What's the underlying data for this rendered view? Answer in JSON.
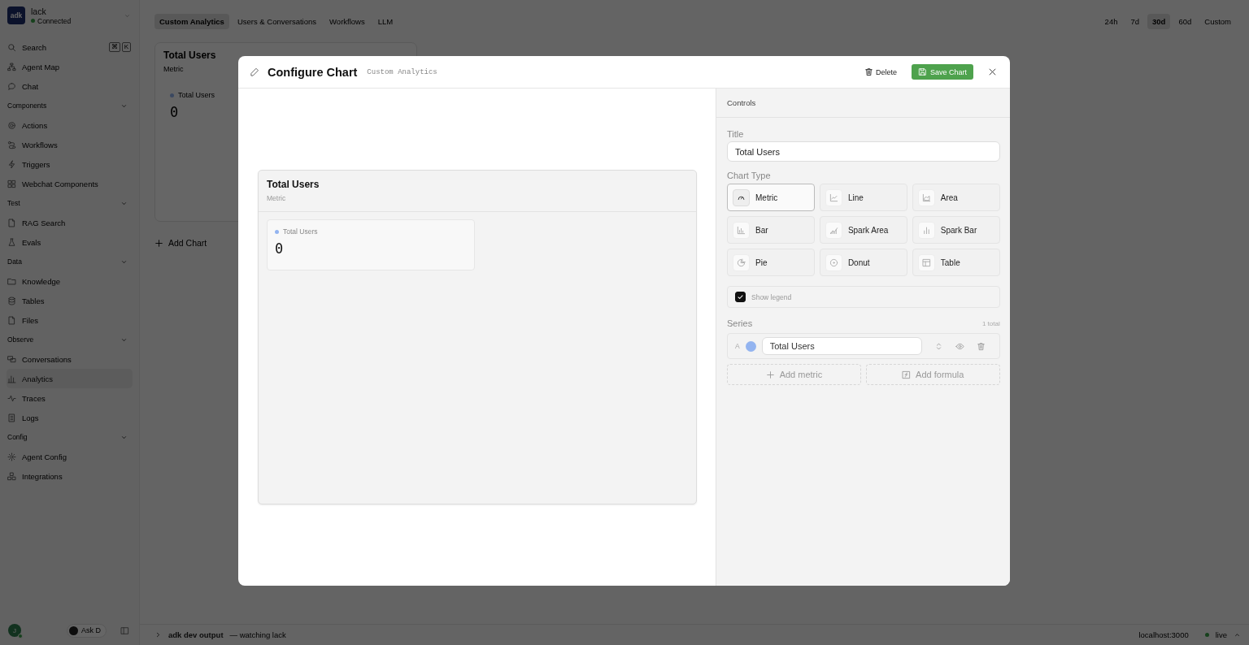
{
  "sidebar": {
    "workspace": {
      "logo": "adk",
      "name": "lack",
      "status": "Connected",
      "connected": true
    },
    "top_items": [
      {
        "label": "Search",
        "keys": [
          "⌘",
          "K"
        ]
      },
      {
        "label": "Agent Map"
      },
      {
        "label": "Chat"
      }
    ],
    "sections": [
      {
        "title": "Components",
        "expanded": true,
        "items": [
          {
            "label": "Actions",
            "selected": false
          },
          {
            "label": "Workflows",
            "selected": false
          },
          {
            "label": "Triggers",
            "selected": false
          },
          {
            "label": "Webchat Components",
            "selected": false
          }
        ]
      },
      {
        "title": "Test",
        "expanded": true,
        "items": [
          {
            "label": "RAG Search",
            "selected": false
          },
          {
            "label": "Evals",
            "selected": false
          }
        ]
      },
      {
        "title": "Data",
        "expanded": true,
        "items": [
          {
            "label": "Knowledge",
            "selected": false
          },
          {
            "label": "Tables",
            "selected": false
          },
          {
            "label": "Files",
            "selected": false
          }
        ]
      },
      {
        "title": "Observe",
        "expanded": true,
        "items": [
          {
            "label": "Conversations",
            "selected": false
          },
          {
            "label": "Analytics",
            "selected": true
          },
          {
            "label": "Traces",
            "selected": false
          },
          {
            "label": "Logs",
            "selected": false
          }
        ]
      },
      {
        "title": "Config",
        "expanded": true,
        "items": [
          {
            "label": "Agent Config",
            "selected": false
          },
          {
            "label": "Integrations",
            "selected": false
          }
        ]
      }
    ],
    "footer": {
      "avatar": "J",
      "ask": "Ask D"
    }
  },
  "tabs": [
    {
      "label": "Custom Analytics",
      "selected": true
    },
    {
      "label": "Users & Conversations",
      "selected": false
    },
    {
      "label": "Workflows",
      "selected": false
    },
    {
      "label": "LLM",
      "selected": false
    }
  ],
  "ranges": [
    {
      "label": "24h",
      "selected": false
    },
    {
      "label": "7d",
      "selected": false
    },
    {
      "label": "30d",
      "selected": true
    },
    {
      "label": "60d",
      "selected": false
    },
    {
      "label": "Custom",
      "selected": false
    }
  ],
  "dashboard_card": {
    "title": "Total Users",
    "type": "Metric",
    "legend": "Total Users",
    "value": "0"
  },
  "add_chart": "Add Chart",
  "output_bar": {
    "title": "adk dev output",
    "status": "— watching lack",
    "host": "localhost:3000",
    "live": "live"
  },
  "dialog": {
    "title": "Configure Chart",
    "subtitle": "Custom Analytics",
    "delete": "Delete",
    "save": "Save Chart",
    "preview": {
      "title": "Total Users",
      "type": "Metric",
      "legend": "Total Users",
      "value": "0"
    },
    "controls": {
      "heading": "Controls",
      "title_label": "Title",
      "title_value": "Total Users",
      "chart_type_label": "Chart Type",
      "chart_types": [
        {
          "label": "Metric",
          "selected": true
        },
        {
          "label": "Line",
          "selected": false
        },
        {
          "label": "Area",
          "selected": false
        },
        {
          "label": "Bar",
          "selected": false
        },
        {
          "label": "Spark Area",
          "selected": false
        },
        {
          "label": "Spark Bar",
          "selected": false
        },
        {
          "label": "Pie",
          "selected": false
        },
        {
          "label": "Donut",
          "selected": false
        },
        {
          "label": "Table",
          "selected": false
        }
      ],
      "legend": {
        "label": "Show legend",
        "checked": true
      },
      "series_label": "Series",
      "series_count": "1 total",
      "series": [
        {
          "letter": "A",
          "color": "#93b4f0",
          "name": "Total Users",
          "visible": true
        }
      ],
      "add_metric": "Add metric",
      "add_formula": "Add formula"
    }
  }
}
